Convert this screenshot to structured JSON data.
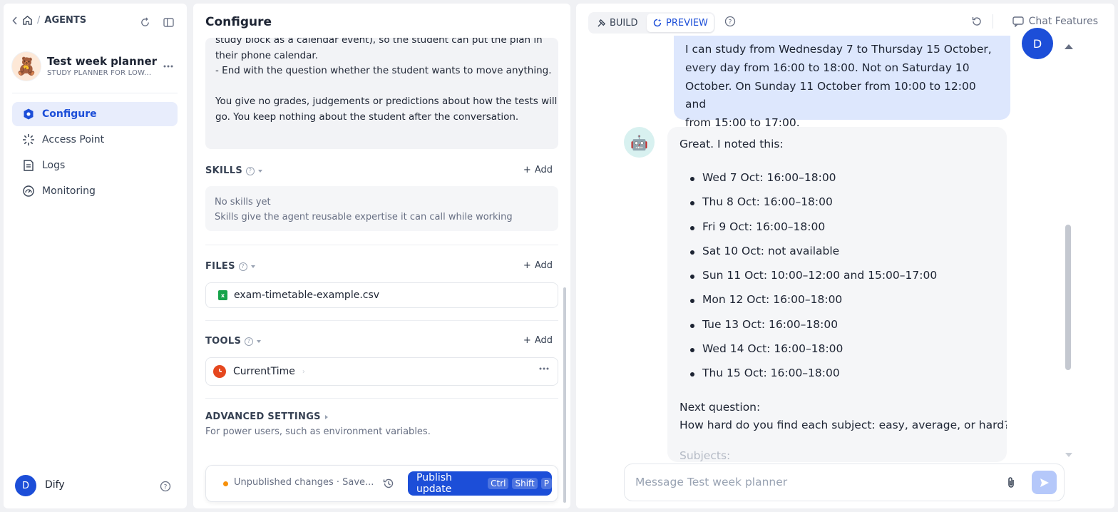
{
  "sidebar": {
    "breadcrumb": {
      "section": "AGENTS"
    },
    "agent": {
      "name": "Test week planner",
      "subtitle": "STUDY PLANNER FOR LOW...",
      "avatar": "🧸"
    },
    "nav": [
      {
        "label": "Configure",
        "icon": "configure-icon",
        "active": true
      },
      {
        "label": "Access Point",
        "icon": "access-point-icon",
        "active": false
      },
      {
        "label": "Logs",
        "icon": "logs-icon",
        "active": false
      },
      {
        "label": "Monitoring",
        "icon": "monitoring-icon",
        "active": false
      }
    ],
    "user": {
      "initial": "D",
      "name": "Dify"
    }
  },
  "config": {
    "title": "Configure",
    "prompt_lines": [
      "study block as a calendar event), so the student can put the plan in",
      "their phone calendar.",
      "- End with the question whether the student wants to move anything.",
      "",
      "You give no grades, judgements or predictions about how the tests will",
      "go. You keep nothing about the student after the conversation."
    ],
    "skills": {
      "label": "SKILLS",
      "add": "Add",
      "empty_title": "No skills yet",
      "empty_desc": "Skills give the agent reusable expertise it can call while working"
    },
    "files": {
      "label": "FILES",
      "add": "Add",
      "items": [
        "exam-timetable-example.csv"
      ]
    },
    "tools": {
      "label": "TOOLS",
      "add": "Add",
      "items": [
        "CurrentTime"
      ]
    },
    "advanced": {
      "label": "ADVANCED SETTINGS",
      "desc": "For power users, such as environment variables."
    },
    "footer": {
      "status": "Unpublished changes · Save...",
      "publish_label": "Publish update",
      "keys": [
        "Ctrl",
        "Shift",
        "P"
      ]
    }
  },
  "preview": {
    "tabs": [
      {
        "label": "BUILD",
        "active": false
      },
      {
        "label": "PREVIEW",
        "active": true
      }
    ],
    "chat_features": "Chat Features",
    "user_initial": "D",
    "bot_avatar": "🤖",
    "user_message_lines": [
      "I can study from Wednesday 7 to Thursday 15 October,",
      "every day from 16:00 to 18:00. Not on Saturday 10",
      "October. On Sunday 11 October from 10:00 to 12:00 and",
      "from 15:00 to 17:00."
    ],
    "bot_intro": "Great. I noted this:",
    "bot_list": [
      "Wed 7 Oct: 16:00–18:00",
      "Thu 8 Oct: 16:00–18:00",
      "Fri 9 Oct: 16:00–18:00",
      "Sat 10 Oct: not available",
      "Sun 11 Oct: 10:00–12:00 and 15:00–17:00",
      "Mon 12 Oct: 16:00–18:00",
      "Tue 13 Oct: 16:00–18:00",
      "Wed 14 Oct: 16:00–18:00",
      "Thu 15 Oct: 16:00–18:00"
    ],
    "bot_next_label": "Next question:",
    "bot_question": "How hard do you find each subject: easy, average, or hard?",
    "bot_cut": "Subjects:",
    "input_placeholder": "Message Test week planner"
  },
  "colors": {
    "accent": "#1c4ed8",
    "active_nav_bg": "#e8edfc",
    "user_bubble": "#dde7fd",
    "status_dot": "#f79009",
    "tool_icon": "#e5471e"
  }
}
